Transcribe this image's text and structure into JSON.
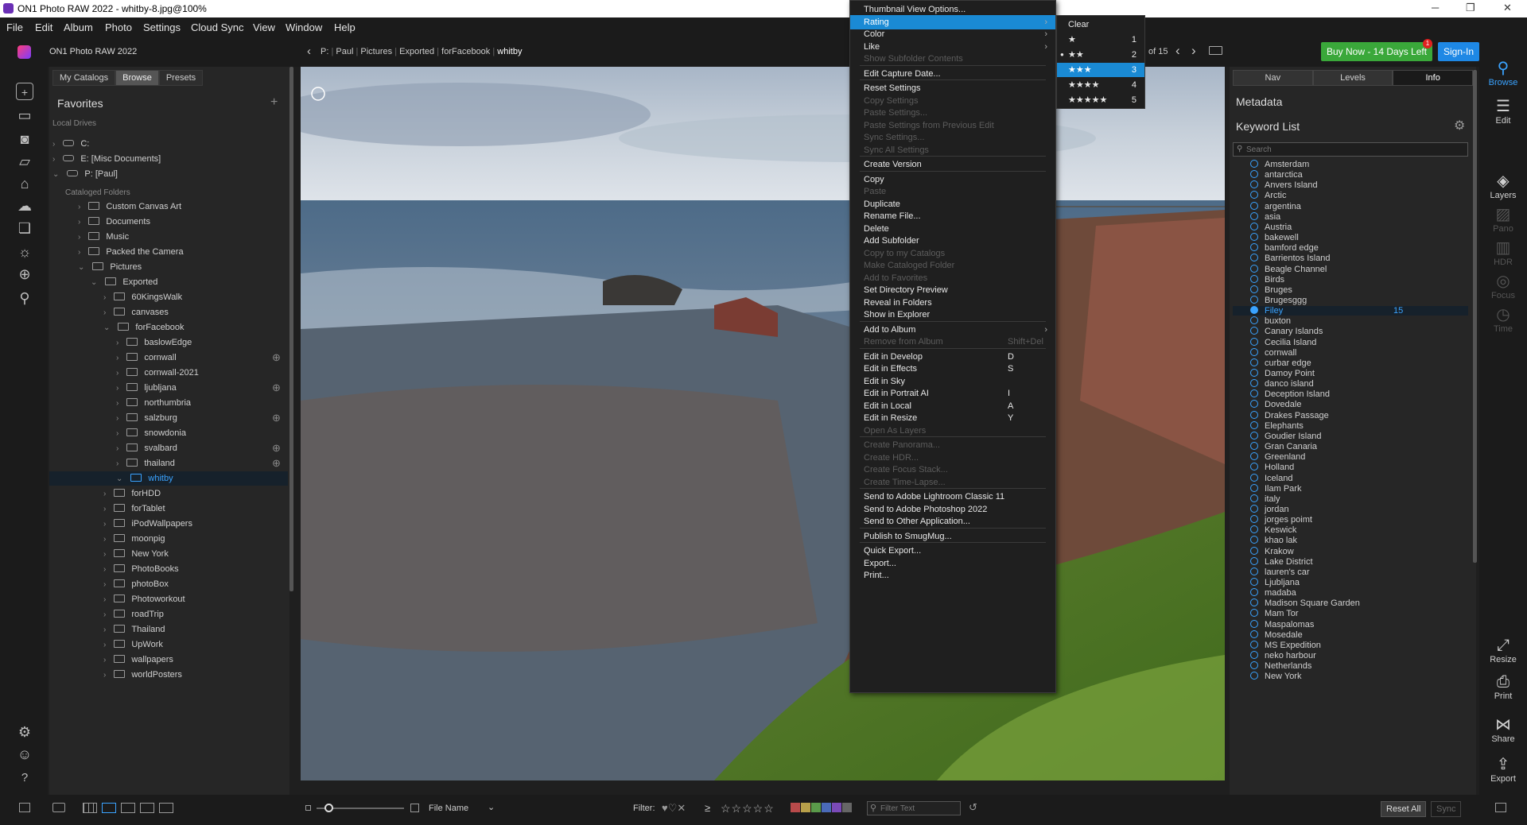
{
  "window": {
    "title": "ON1 Photo RAW 2022 - whitby-8.jpg@100%",
    "minimize": "─",
    "restore": "❐",
    "close": "✕"
  },
  "menubar": [
    "File",
    "Edit",
    "Album",
    "Photo",
    "Settings",
    "Cloud Sync",
    "View",
    "Window",
    "Help"
  ],
  "topbar": {
    "app_name": "ON1 Photo RAW 2022",
    "breadcrumb": [
      "P:",
      "Paul",
      "Pictures",
      "Exported",
      "forFacebook",
      "whitby"
    ],
    "counter": "of 15",
    "buy_label": "Buy Now - 14 Days Left",
    "badge": "1",
    "signin_label": "Sign-In"
  },
  "left": {
    "tabs": [
      "My Catalogs",
      "Browse",
      "Presets"
    ],
    "favorites_title": "Favorites",
    "add_symbol": "+",
    "local_drives_label": "Local Drives",
    "drives": [
      "C:",
      "E: [Misc Documents]",
      "P: [Paul]"
    ],
    "cataloged_label": "Cataloged Folders",
    "folders": [
      "Custom Canvas Art",
      "Documents",
      "Music",
      "Packed the Camera",
      "Pictures",
      "Exported",
      "60KingsWalk",
      "canvases",
      "forFacebook",
      "baslowEdge",
      "cornwall",
      "cornwall-2021",
      "ljubljana",
      "northumbria",
      "salzburg",
      "snowdonia",
      "svalbard",
      "thailand",
      "whitby",
      "forHDD",
      "forTablet",
      "iPodWallpapers",
      "moonpig",
      "New York",
      "PhotoBooks",
      "photoBox",
      "Photoworkout",
      "roadTrip",
      "Thailand",
      "UpWork",
      "wallpapers",
      "worldPosters"
    ]
  },
  "right": {
    "tabs": [
      "Nav",
      "Levels",
      "Info"
    ],
    "metadata_title": "Metadata",
    "keyword_title": "Keyword List",
    "search_placeholder": "Search",
    "selected_keyword": "Filey",
    "selected_count": "15",
    "keywords": [
      "Amsterdam",
      "antarctica",
      "Anvers Island",
      "Arctic",
      "argentina",
      "asia",
      "Austria",
      "bakewell",
      "bamford edge",
      "Barrientos Island",
      "Beagle Channel",
      "Birds",
      "Bruges",
      "Brugesggg",
      "Filey",
      "buxton",
      "Canary Islands",
      "Cecilia Island",
      "cornwall",
      "curbar edge",
      "Damoy Point",
      "danco island",
      "Deception Island",
      "Dovedale",
      "Drakes Passage",
      "Elephants",
      "Goudier Island",
      "Gran Canaria",
      "Greenland",
      "Holland",
      "Iceland",
      "Ilam Park",
      "italy",
      "jordan",
      "jorges poimt",
      "Keswick",
      "khao lak",
      "Krakow",
      "Lake District",
      "lauren's car",
      "Ljubljana",
      "madaba",
      "Madison Square Garden",
      "Mam Tor",
      "Maspalomas",
      "Mosedale",
      "MS Expedition",
      "neko harbour",
      "Netherlands",
      "New York"
    ]
  },
  "rightstrip": {
    "browse": "Browse",
    "edit": "Edit",
    "layers": "Layers",
    "pano": "Pano",
    "hdr": "HDR",
    "focus": "Focus",
    "time": "Time",
    "resize": "Resize",
    "print": "Print",
    "share": "Share",
    "export": "Export"
  },
  "bottom": {
    "sort_label": "File Name",
    "filter_label": "Filter:",
    "filter_placeholder": "Filter Text",
    "reset_label": "Reset All",
    "sync_label": "Sync",
    "stars": "☆☆☆☆☆"
  },
  "context_menu": [
    {
      "label": "Thumbnail View Options...",
      "state": "normal"
    },
    {
      "label": "Rating",
      "state": "hl",
      "arrow": true
    },
    {
      "label": "Color",
      "state": "normal",
      "arrow": true
    },
    {
      "label": "Like",
      "state": "normal",
      "arrow": true
    },
    {
      "label": "Show Subfolder Contents",
      "state": "dis"
    },
    {
      "sep": true
    },
    {
      "label": "Edit Capture Date...",
      "state": "normal"
    },
    {
      "sep": true
    },
    {
      "label": "Reset Settings",
      "state": "normal"
    },
    {
      "label": "Copy Settings",
      "state": "dis"
    },
    {
      "label": "Paste Settings...",
      "state": "dis"
    },
    {
      "label": "Paste Settings from Previous Edit",
      "state": "dis"
    },
    {
      "label": "Sync Settings...",
      "state": "dis"
    },
    {
      "label": "Sync All Settings",
      "state": "dis"
    },
    {
      "sep": true
    },
    {
      "label": "Create Version",
      "state": "normal"
    },
    {
      "sep": true
    },
    {
      "label": "Copy",
      "state": "normal"
    },
    {
      "label": "Paste",
      "state": "dis"
    },
    {
      "label": "Duplicate",
      "state": "normal"
    },
    {
      "label": "Rename File...",
      "state": "normal"
    },
    {
      "label": "Delete",
      "state": "normal"
    },
    {
      "label": "Add Subfolder",
      "state": "normal"
    },
    {
      "label": "Copy to my Catalogs",
      "state": "dis"
    },
    {
      "label": "Make Cataloged Folder",
      "state": "dis"
    },
    {
      "label": "Add to Favorites",
      "state": "dis"
    },
    {
      "label": "Set Directory Preview",
      "state": "normal"
    },
    {
      "label": "Reveal in Folders",
      "state": "normal"
    },
    {
      "label": "Show in Explorer",
      "state": "normal"
    },
    {
      "sep": true
    },
    {
      "label": "Add to Album",
      "state": "normal",
      "arrow": true
    },
    {
      "label": "Remove from Album",
      "state": "dis",
      "shortcut": "Shift+Del"
    },
    {
      "sep": true
    },
    {
      "label": "Edit in Develop",
      "state": "normal",
      "shortcut": "D"
    },
    {
      "label": "Edit in Effects",
      "state": "normal",
      "shortcut": "S"
    },
    {
      "label": "Edit in Sky",
      "state": "normal"
    },
    {
      "label": "Edit in Portrait AI",
      "state": "normal",
      "shortcut": "I"
    },
    {
      "label": "Edit in Local",
      "state": "normal",
      "shortcut": "A"
    },
    {
      "label": "Edit in Resize",
      "state": "normal",
      "shortcut": "Y"
    },
    {
      "label": "Open As Layers",
      "state": "dis"
    },
    {
      "sep": true
    },
    {
      "label": "Create Panorama...",
      "state": "dis"
    },
    {
      "label": "Create HDR...",
      "state": "dis"
    },
    {
      "label": "Create Focus Stack...",
      "state": "dis"
    },
    {
      "label": "Create Time-Lapse...",
      "state": "dis"
    },
    {
      "sep": true
    },
    {
      "label": "Send to Adobe Lightroom Classic 11",
      "state": "normal"
    },
    {
      "label": "Send to Adobe Photoshop 2022",
      "state": "normal"
    },
    {
      "label": "Send to Other Application...",
      "state": "normal"
    },
    {
      "sep": true
    },
    {
      "label": "Publish to SmugMug...",
      "state": "normal"
    },
    {
      "sep": true
    },
    {
      "label": "Quick Export...",
      "state": "normal"
    },
    {
      "label": "Export...",
      "state": "normal"
    },
    {
      "label": "Print...",
      "state": "normal"
    }
  ],
  "rating_submenu": [
    {
      "label": "Clear",
      "value": ""
    },
    {
      "label": "★",
      "value": "1"
    },
    {
      "label": "★★",
      "value": "2"
    },
    {
      "label": "★★★",
      "value": "3"
    },
    {
      "label": "★★★★",
      "value": "4"
    },
    {
      "label": "★★★★★",
      "value": "5"
    }
  ]
}
